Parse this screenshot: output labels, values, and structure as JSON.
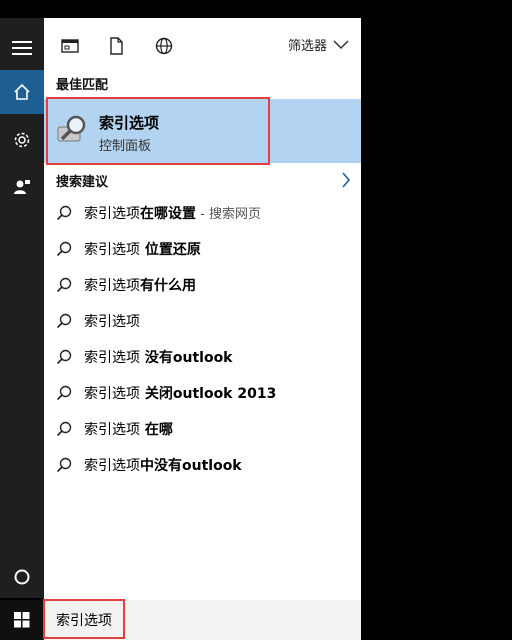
{
  "toolbar": {
    "filter_label": "筛选器"
  },
  "best_match": {
    "heading": "最佳匹配",
    "title": "索引选项",
    "subtitle": "控制面板"
  },
  "suggestions_heading": "搜索建议",
  "suggestions": [
    {
      "base": "索引选项",
      "bold": "在哪设置",
      "extra": " - 搜索网页"
    },
    {
      "base": "索引选项",
      "bold": " 位置还原",
      "extra": ""
    },
    {
      "base": "索引选项",
      "bold": "有什么用",
      "extra": ""
    },
    {
      "base": "索引选项",
      "bold": "",
      "extra": ""
    },
    {
      "base": "索引选项",
      "bold": " 没有outlook",
      "extra": ""
    },
    {
      "base": "索引选项",
      "bold": " 关闭outlook 2013",
      "extra": ""
    },
    {
      "base": "索引选项",
      "bold": " 在哪",
      "extra": ""
    },
    {
      "base": "索引选项",
      "bold": "中没有outlook",
      "extra": ""
    }
  ],
  "search": {
    "value": "索引选项"
  },
  "colors": {
    "accent": "#1e5f93",
    "highlight": "#b3d4f0",
    "annotation": "#e04040"
  }
}
